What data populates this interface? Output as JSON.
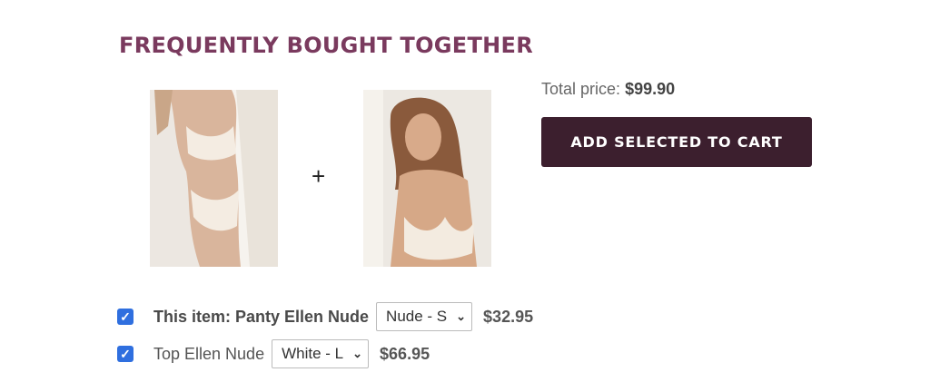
{
  "section": {
    "title": "FREQUENTLY BOUGHT TOGETHER"
  },
  "products_images": {
    "plus": "+"
  },
  "summary": {
    "total_label": "Total price:",
    "total_value": "$99.90",
    "add_button_label": "ADD SELECTED TO CART"
  },
  "items": [
    {
      "checked": true,
      "name": "This item: Panty Ellen Nude",
      "variant": "Nude - S",
      "price": "$32.95"
    },
    {
      "checked": true,
      "name": "Top Ellen Nude",
      "variant": "White - L",
      "price": "$66.95"
    }
  ],
  "colors": {
    "accent": "#7a3a5e",
    "button": "#3c1f2e",
    "checkbox": "#2f6fdf"
  }
}
